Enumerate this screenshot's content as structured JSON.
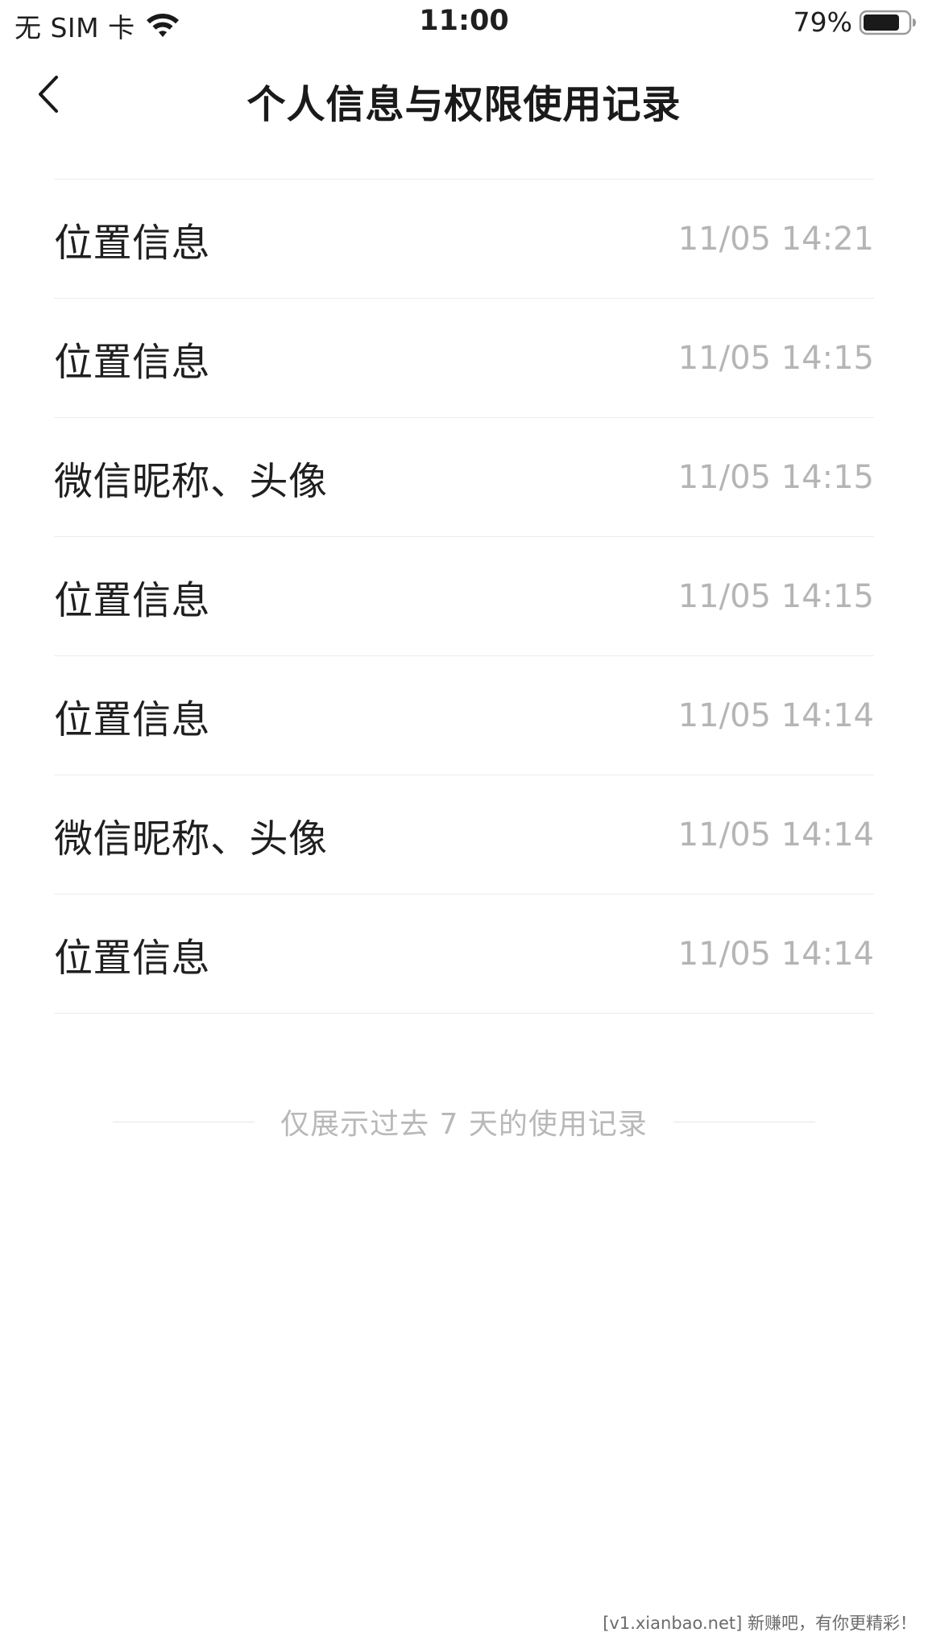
{
  "status_bar": {
    "carrier": "无 SIM 卡",
    "time": "11:00",
    "battery_percent": "79%",
    "wifi_icon": "wifi-icon",
    "battery_icon": "battery-icon"
  },
  "nav": {
    "back_icon": "chevron-left-icon",
    "title": "个人信息与权限使用记录"
  },
  "records": [
    {
      "name": "位置信息",
      "time": "11/05 14:21"
    },
    {
      "name": "位置信息",
      "time": "11/05 14:15"
    },
    {
      "name": "微信昵称、头像",
      "time": "11/05 14:15"
    },
    {
      "name": "位置信息",
      "time": "11/05 14:15"
    },
    {
      "name": "位置信息",
      "time": "11/05 14:14"
    },
    {
      "name": "微信昵称、头像",
      "time": "11/05 14:14"
    },
    {
      "name": "位置信息",
      "time": "11/05 14:14"
    }
  ],
  "footer": {
    "note": "仅展示过去 7 天的使用记录"
  },
  "watermark": "[v1.xianbao.net] 新赚吧，有你更精彩！"
}
